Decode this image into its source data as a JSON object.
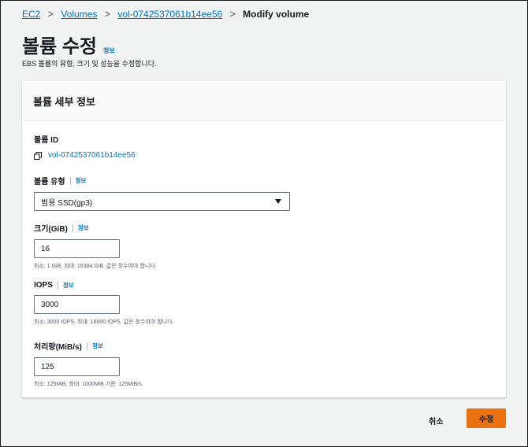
{
  "breadcrumb": {
    "items": [
      "EC2",
      "Volumes",
      "vol-0742537061b14ee56"
    ],
    "current": "Modify volume",
    "separator": ">"
  },
  "page": {
    "title": "볼륨 수정",
    "info_label": "정보",
    "subtitle": "EBS 볼륨의 유형, 크기 및 성능을 수정합니다."
  },
  "panel": {
    "header": "볼륨 세부 정보",
    "volume_id": {
      "label": "볼륨 ID",
      "value": "vol-0742537061b14ee56",
      "icon": "copy-icon"
    },
    "volume_type": {
      "label": "볼륨 유형",
      "info": "정보",
      "value": "범용 SSD(gp3)"
    },
    "size": {
      "label": "크기(GiB)",
      "info": "정보",
      "value": "16",
      "hint": "최소: 1 GiB, 최대: 16384 GiB. 값은 정수여야 합니다."
    },
    "iops": {
      "label": "IOPS",
      "info": "정보",
      "value": "3000",
      "hint": "최소: 3000 IOPS, 최대: 16000 IOPS. 값은 정수여야 합니다."
    },
    "throughput": {
      "label": "처리량(MiB/s)",
      "info": "정보",
      "value": "125",
      "hint": "최소: 125MiB, 최대: 1000MiB 기준: 125MiB/s."
    }
  },
  "actions": {
    "cancel": "취소",
    "submit": "수정"
  },
  "colors": {
    "link": "#0073bb",
    "primary_button": "#ec7211",
    "background": "#f2f3f3"
  }
}
